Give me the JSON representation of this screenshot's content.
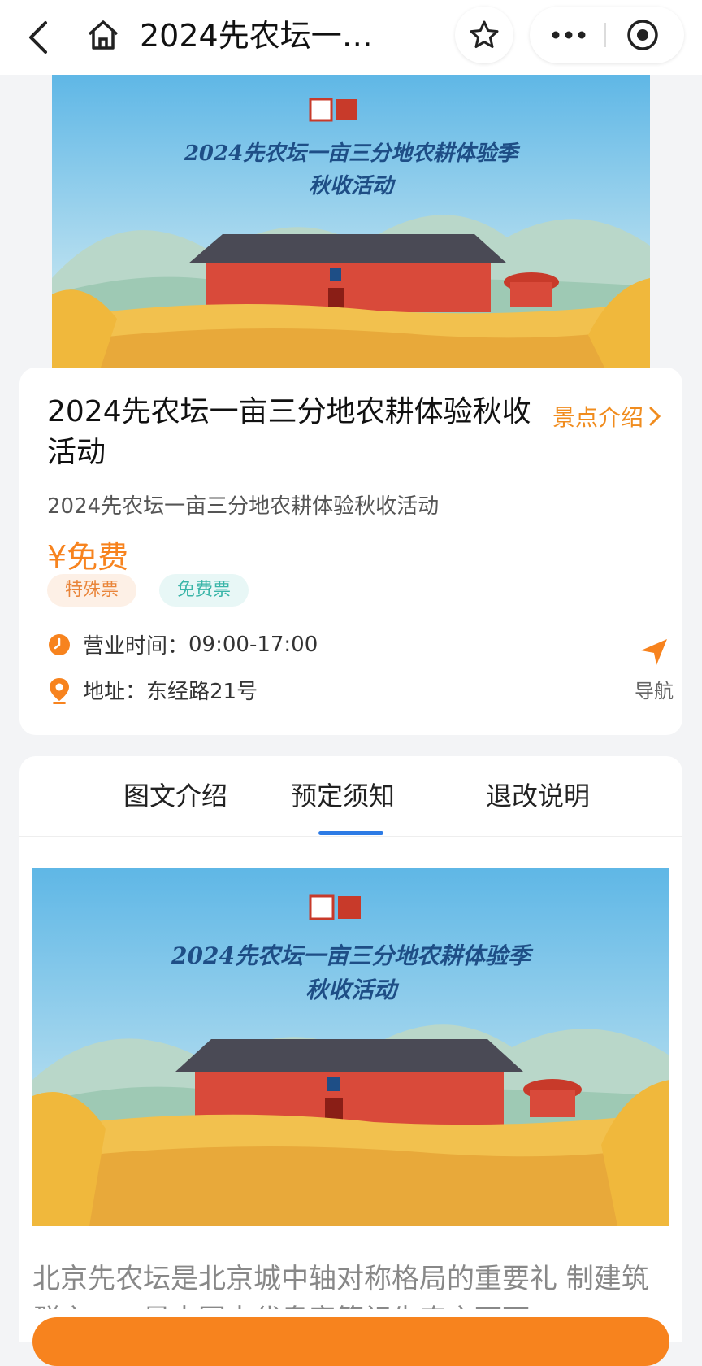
{
  "nav": {
    "title": "2024先农坛一…",
    "icons": [
      "back-arrow-icon",
      "home-icon",
      "star-icon",
      "more-icon",
      "target-circle-icon"
    ]
  },
  "banner": {
    "title_line1": "2024先农坛一亩三分地农耕体验季",
    "title_line2": "秋收活动"
  },
  "event": {
    "title": "2024先农坛一亩三分地农耕体验秋收活动",
    "intro_link": "景点介绍",
    "subtitle": "2024先农坛一亩三分地农耕体验秋收活动",
    "price": "¥免费",
    "tags": [
      "特殊票",
      "免费票"
    ],
    "hours_label": "营业时间：",
    "hours_value": "09:00-17:00",
    "address_label": "地址：",
    "address_value": "东经路21号",
    "navigate_label": "导航"
  },
  "tabs": [
    "图文介绍",
    "预定须知",
    "退改说明"
  ],
  "active_tab": 1,
  "description": "北京先农坛是北京城中轴对称格局的重要礼 制建筑群之一，是中国古代皇帝等祀先农之下可",
  "colors": {
    "accent_orange": "#f7831e",
    "link_orange": "#f08c1e",
    "tab_blue": "#2d7be5",
    "background": "#f3f4f6"
  }
}
